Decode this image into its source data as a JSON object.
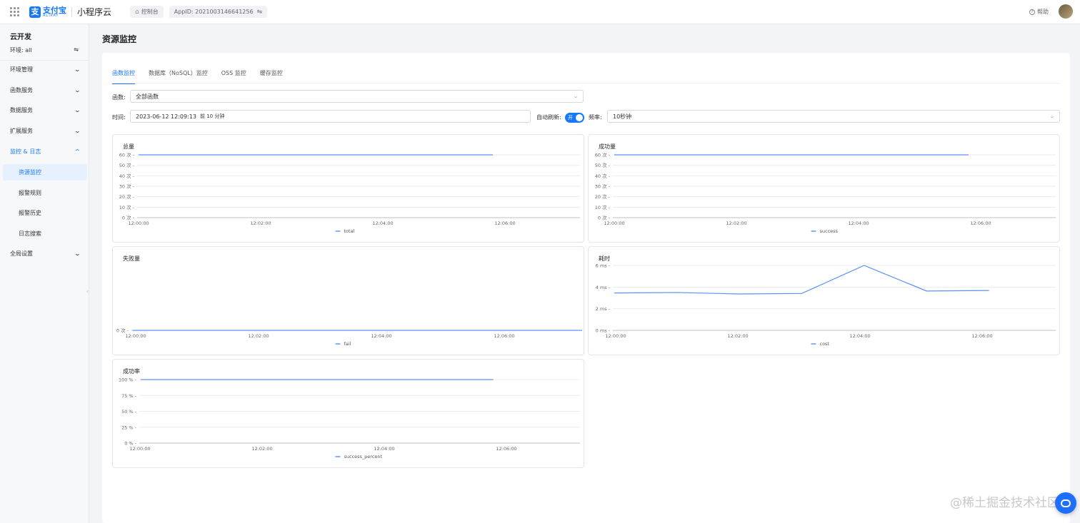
{
  "topbar": {
    "logo_cn": "支付宝",
    "logo_en": "ALIPAY",
    "product": "小程序云",
    "console": "控制台",
    "appid": "AppID: 2021003146641256",
    "help": "帮助"
  },
  "sidebar": {
    "title": "云开发",
    "env_label": "环境: all",
    "items": [
      {
        "label": "环境管理"
      },
      {
        "label": "函数服务"
      },
      {
        "label": "数据服务"
      },
      {
        "label": "扩展服务"
      },
      {
        "label": "监控 & 日志"
      },
      {
        "label": "全局设置"
      }
    ],
    "subitems": [
      {
        "label": "资源监控"
      },
      {
        "label": "报警规则"
      },
      {
        "label": "报警历史"
      },
      {
        "label": "日志搜索"
      }
    ]
  },
  "page": {
    "title": "资源监控",
    "tabs": [
      "函数监控",
      "数据库（NoSQL）监控",
      "OSS 监控",
      "缓存监控"
    ],
    "func_label": "函数:",
    "func_value": "全部函数",
    "time_label": "时间:",
    "time_value": "2023-06-12 12:09:13",
    "time_range": "前 10 分钟",
    "auto_refresh_label": "自动刷新:",
    "toggle_text": "开",
    "freq_label": "频率:",
    "freq_value": "10秒钟"
  },
  "chart_data": [
    {
      "type": "line",
      "title": "总量",
      "x": [
        "12:00:00",
        "12:02:00",
        "12:04:00",
        "12:06:00"
      ],
      "yticks": [
        "0 次",
        "10 次",
        "20 次",
        "30 次",
        "40 次",
        "50 次",
        "60 次"
      ],
      "ylim": [
        0,
        60
      ],
      "series": [
        {
          "name": "total",
          "x": [
            0,
            6.0
          ],
          "values": [
            60,
            60
          ]
        }
      ]
    },
    {
      "type": "line",
      "title": "成功量",
      "x": [
        "12:00:00",
        "12:02:00",
        "12:04:00",
        "12:06:00"
      ],
      "yticks": [
        "0 次",
        "10 次",
        "20 次",
        "30 次",
        "40 次",
        "50 次",
        "60 次"
      ],
      "ylim": [
        0,
        60
      ],
      "series": [
        {
          "name": "success",
          "x": [
            0,
            6.0
          ],
          "values": [
            60,
            60
          ]
        }
      ]
    },
    {
      "type": "line",
      "title": "失败量",
      "x": [
        "12:00:00",
        "12:02:00",
        "12:04:00",
        "12:06:00"
      ],
      "yticks": [
        "0 次"
      ],
      "ylim": [
        0,
        1
      ],
      "series": [
        {
          "name": "fail",
          "x": [
            0,
            7.4
          ],
          "values": [
            0,
            0
          ]
        }
      ]
    },
    {
      "type": "line",
      "title": "耗时",
      "x": [
        "12:00:00",
        "12:02:00",
        "12:04:00",
        "12:06:00"
      ],
      "yticks": [
        "0 ms",
        "2 ms",
        "4 ms",
        "6 ms"
      ],
      "ylim": [
        0,
        6.6
      ],
      "series": [
        {
          "name": "cost",
          "x": [
            0,
            1,
            2,
            3,
            4,
            5,
            6
          ],
          "values": [
            3.8,
            3.85,
            3.7,
            3.75,
            6.6,
            4.0,
            4.05
          ]
        }
      ]
    },
    {
      "type": "line",
      "title": "成功率",
      "x": [
        "12:00:00",
        "12:02:00",
        "12:04:00",
        "12:06:00"
      ],
      "yticks": [
        "0 %",
        "25 %",
        "50 %",
        "75 %",
        "100 %"
      ],
      "ylim": [
        0,
        100
      ],
      "series": [
        {
          "name": "success_percent",
          "x": [
            0,
            6.0
          ],
          "values": [
            100,
            100
          ]
        }
      ]
    }
  ],
  "watermark": "@稀土掘金技术社区",
  "colors": {
    "accent": "#1677ff",
    "line": "#5b8ff9"
  }
}
